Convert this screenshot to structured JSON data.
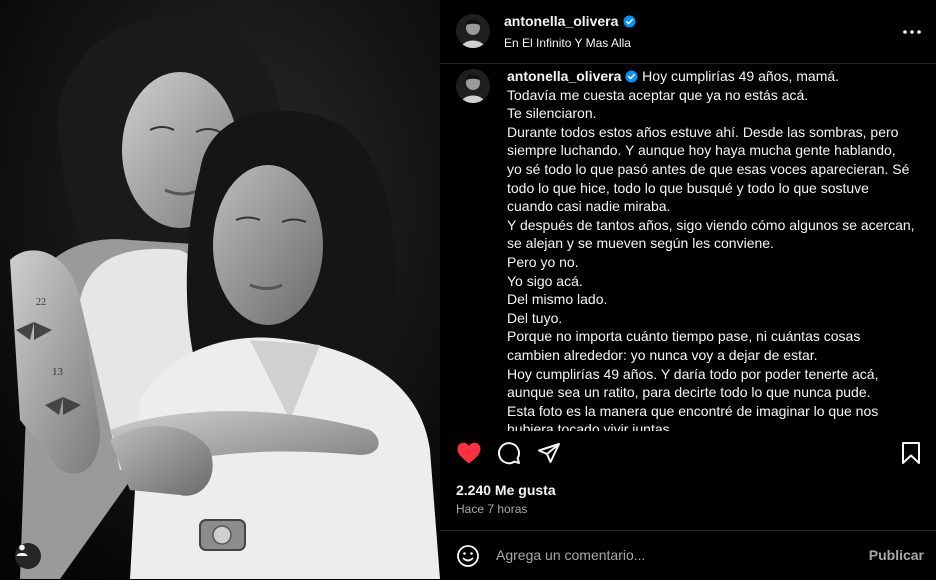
{
  "colors": {
    "like": "#ff3040",
    "verified": "#0095f6",
    "text": "#f5f5f5",
    "muted": "#a8a8a8"
  },
  "post": {
    "photo_alt": "Black and white portrait of two women embracing",
    "tag_icon": "user-tag-icon"
  },
  "header": {
    "username": "antonella_olivera",
    "subtitle": "En El Infinito Y Mas Alla",
    "more_icon": "more-options-icon"
  },
  "caption": {
    "username": "antonella_olivera",
    "first_line": "Hoy cumplirías 49 años, mamá.",
    "lines": [
      "Todavía me cuesta aceptar que ya no estás acá.",
      "Te silenciaron.",
      "Durante todos estos años estuve ahí. Desde las sombras, pero",
      "siempre luchando. Y aunque hoy haya mucha gente hablando,",
      "yo sé todo lo que pasó antes de que esas voces aparecieran. Sé",
      "todo lo que hice, todo lo que busqué y todo lo que sostuve",
      "cuando casi nadie miraba.",
      "Y después de tantos años, sigo viendo cómo algunos se acercan,",
      "se alejan y se mueven según les conviene.",
      "Pero yo no.",
      "Yo sigo acá.",
      "Del mismo lado.",
      "Del tuyo.",
      "Porque no importa cuánto tiempo pase, ni cuántas cosas",
      "cambien alrededor: yo nunca voy a dejar de estar.",
      "Hoy cumplirías 49 años. Y daría todo por poder tenerte acá,",
      "aunque sea un ratito, para decirte todo lo que nunca pude.",
      "Esta foto es la manera que encontré de imaginar lo que nos",
      "hubiera tocado vivir juntas."
    ]
  },
  "actions": {
    "like_icon": "heart-filled-icon",
    "comment_icon": "comment-icon",
    "share_icon": "share-icon",
    "save_icon": "bookmark-icon"
  },
  "stats": {
    "likes": "2.240 Me gusta",
    "time": "Hace 7 horas"
  },
  "comment": {
    "placeholder": "Agrega un comentario...",
    "post_label": "Publicar",
    "emoji_icon": "emoji-icon"
  }
}
